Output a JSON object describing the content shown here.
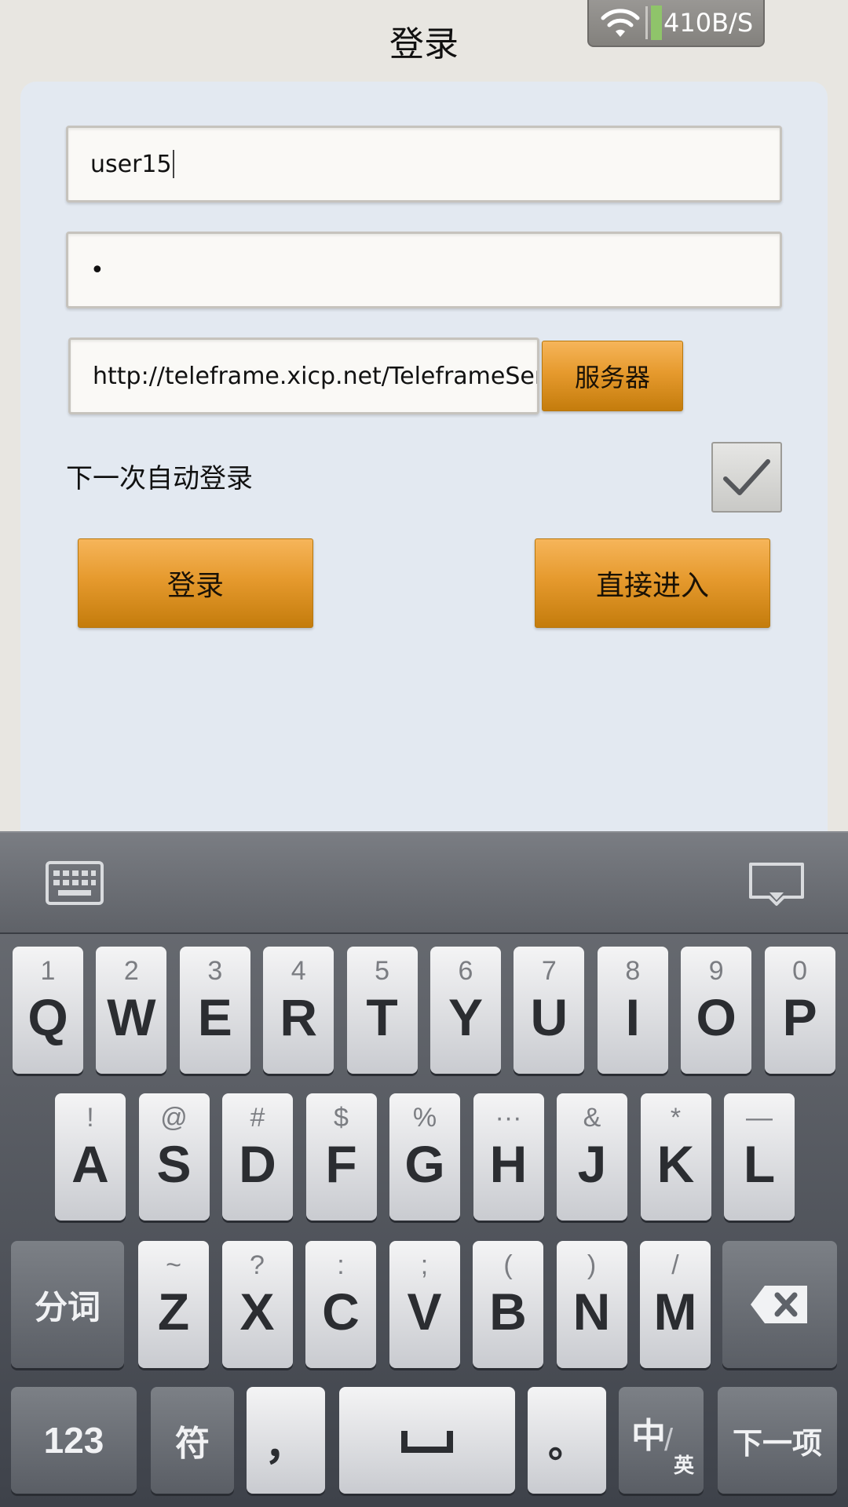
{
  "header": {
    "title": "登录",
    "network_speed": "410B/S"
  },
  "form": {
    "username_value": "user15",
    "password_value": "•",
    "server_url_value": "http://teleframe.xicp.net/TeleframeServi",
    "server_button_label": "服务器",
    "auto_login_label": "下一次自动登录",
    "auto_login_checked": true,
    "login_button_label": "登录",
    "enter_button_label": "直接进入"
  },
  "keyboard": {
    "row1": [
      {
        "sub": "1",
        "main": "Q"
      },
      {
        "sub": "2",
        "main": "W"
      },
      {
        "sub": "3",
        "main": "E"
      },
      {
        "sub": "4",
        "main": "R"
      },
      {
        "sub": "5",
        "main": "T"
      },
      {
        "sub": "6",
        "main": "Y"
      },
      {
        "sub": "7",
        "main": "U"
      },
      {
        "sub": "8",
        "main": "I"
      },
      {
        "sub": "9",
        "main": "O"
      },
      {
        "sub": "0",
        "main": "P"
      }
    ],
    "row2": [
      {
        "sub": "!",
        "main": "A"
      },
      {
        "sub": "@",
        "main": "S"
      },
      {
        "sub": "#",
        "main": "D"
      },
      {
        "sub": "$",
        "main": "F"
      },
      {
        "sub": "%",
        "main": "G"
      },
      {
        "sub": "···",
        "main": "H"
      },
      {
        "sub": "&",
        "main": "J"
      },
      {
        "sub": "*",
        "main": "K"
      },
      {
        "sub": "—",
        "main": "L"
      }
    ],
    "row3": [
      {
        "sub": "~",
        "main": "Z"
      },
      {
        "sub": "?",
        "main": "X"
      },
      {
        "sub": ":",
        "main": "C"
      },
      {
        "sub": ";",
        "main": "V"
      },
      {
        "sub": "(",
        "main": "B"
      },
      {
        "sub": ")",
        "main": "N"
      },
      {
        "sub": "/",
        "main": "M"
      }
    ],
    "segment_label": "分词",
    "numbers_label": "123",
    "symbols_label": "符",
    "comma_label": "，",
    "period_label": "。",
    "lang_main": "中",
    "lang_sub": "英",
    "next_label": "下一项"
  }
}
